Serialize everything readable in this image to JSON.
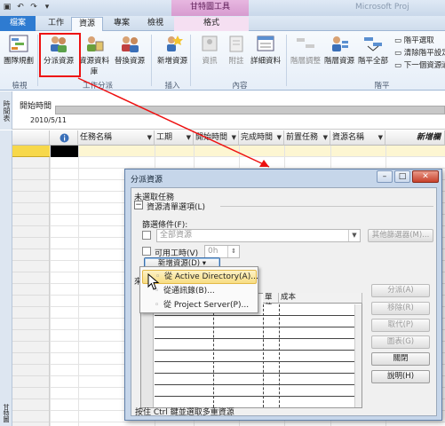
{
  "window": {
    "tool_tab_header": "甘特圖工具",
    "app_title": "Microsoft Proj"
  },
  "tabs": [
    {
      "label": "檔案"
    },
    {
      "label": "工作"
    },
    {
      "label": "資源"
    },
    {
      "label": "專案"
    },
    {
      "label": "檢視"
    },
    {
      "label": "格式"
    }
  ],
  "ribbon": {
    "buttons": [
      {
        "label": "團隊規劃"
      },
      {
        "label": "分派資源"
      },
      {
        "label": "資源資料庫"
      },
      {
        "label": "替換資源"
      },
      {
        "label": "新增資源"
      },
      {
        "label": "資訊"
      },
      {
        "label": "附註"
      },
      {
        "label": "詳細資料"
      },
      {
        "label": "階層調整"
      },
      {
        "label": "階層資源"
      },
      {
        "label": "階平全部"
      }
    ],
    "level_cmds": [
      "階平選取",
      "清除階平設定",
      "下一個資源過"
    ],
    "groups": [
      "檢視",
      "工作分派",
      "插入",
      "內容",
      "階平"
    ]
  },
  "timeline": {
    "side_label": "時間表",
    "start_label": "開始時間",
    "start_date": "2010/5/11"
  },
  "grid": {
    "side_label": "甘特圖",
    "columns": [
      "任務名稱",
      "工期",
      "開始時間",
      "完成時間",
      "前置任務",
      "資源名稱",
      "新增欄"
    ]
  },
  "dialog": {
    "title": "分派資源",
    "task_status": "未選取任務",
    "options_toggle": "−",
    "options_label": "資源清單選項(L)",
    "filter_label": "篩選條件(F):",
    "filter_value": "全部資源",
    "more_filters": "其他篩選器(M)...",
    "available_label": "可用工時(V)",
    "available_value": "0h",
    "add_resources": "新增資源(D)",
    "partial_label": "來",
    "table_cols": [
      "單位",
      "成本"
    ],
    "buttons": {
      "assign": "分派(A)",
      "remove": "移除(R)",
      "replace": "取代(P)",
      "graphs": "圖表(G)",
      "close": "關閉",
      "help": "說明(H)"
    },
    "footer": "按住 Ctrl 鍵並選取多重資源"
  },
  "menu": {
    "items": [
      {
        "label": "從 Active Directory(A)..."
      },
      {
        "label": "從通訊錄(B)..."
      },
      {
        "label": "從 Project Server(P)..."
      }
    ]
  },
  "colors": {
    "file_tab": "#2e7bd1",
    "tool_tab": "#d79bd0",
    "highlight_red": "#e11111",
    "menu_highlight": "#f8dd83"
  }
}
